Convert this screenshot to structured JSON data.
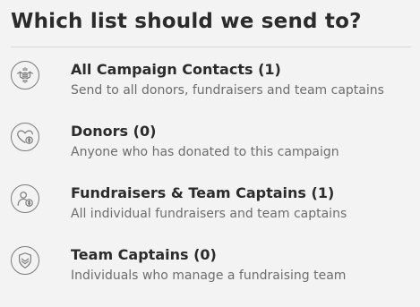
{
  "header": {
    "title": "Which list should we send to?"
  },
  "lists": [
    {
      "label": "All Campaign Contacts (1)",
      "description": "Send to all donors, fundraisers and team captains",
      "icon": "handshake-icon"
    },
    {
      "label": "Donors (0)",
      "description": "Anyone who has donated to this campaign",
      "icon": "heart-dollar-icon"
    },
    {
      "label": "Fundraisers & Team Captains (1)",
      "description": "All individual fundraisers and team captains",
      "icon": "person-dollar-icon"
    },
    {
      "label": "Team Captains (0)",
      "description": "Individuals who manage a fundraising team",
      "icon": "shield-icon"
    }
  ],
  "colors": {
    "background": "#f3f3f3",
    "icon_stroke": "#7b7b7b",
    "heading": "#2b2b2b",
    "description": "#6d6d6d",
    "divider": "#d8d8d8"
  }
}
